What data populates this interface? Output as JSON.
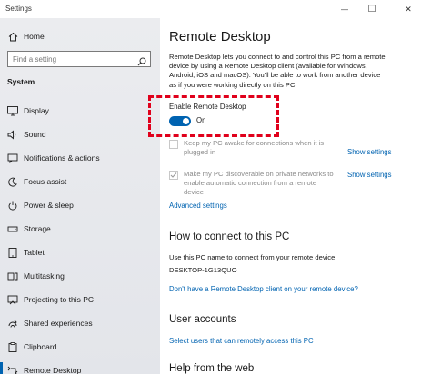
{
  "window": {
    "title": "Settings",
    "minimize": "—",
    "maximize": "☐",
    "close": "✕"
  },
  "sidebar": {
    "home": "Home",
    "search_placeholder": "Find a setting",
    "section": "System",
    "items": [
      {
        "label": "Display",
        "icon": "display-icon"
      },
      {
        "label": "Sound",
        "icon": "sound-icon"
      },
      {
        "label": "Notifications & actions",
        "icon": "notifications-icon"
      },
      {
        "label": "Focus assist",
        "icon": "focus-assist-icon"
      },
      {
        "label": "Power & sleep",
        "icon": "power-icon"
      },
      {
        "label": "Storage",
        "icon": "storage-icon"
      },
      {
        "label": "Tablet",
        "icon": "tablet-icon"
      },
      {
        "label": "Multitasking",
        "icon": "multitasking-icon"
      },
      {
        "label": "Projecting to this PC",
        "icon": "projecting-icon"
      },
      {
        "label": "Shared experiences",
        "icon": "shared-experiences-icon"
      },
      {
        "label": "Clipboard",
        "icon": "clipboard-icon"
      },
      {
        "label": "Remote Desktop",
        "icon": "remote-desktop-icon"
      }
    ],
    "selected": "Remote Desktop"
  },
  "main": {
    "title": "Remote Desktop",
    "description": "Remote Desktop lets you connect to and control this PC from a remote device by using a Remote Desktop client (available for Windows, Android, iOS and macOS). You'll be able to work from another device as if you were working directly on this PC.",
    "enable_label": "Enable Remote Desktop",
    "toggle_state": "On",
    "toggle_on": true,
    "option1": {
      "text": "Keep my PC awake for connections when it is plugged in",
      "checked": false,
      "link": "Show settings"
    },
    "option2": {
      "text": "Make my PC discoverable on private networks to enable automatic connection from a remote device",
      "checked": true,
      "link": "Show settings"
    },
    "advanced_link": "Advanced settings",
    "connect_heading": "How to connect to this PC",
    "connect_text": "Use this PC name to connect from your remote device:",
    "pc_name": "DESKTOP-1G13QUO",
    "client_link": "Don't have a Remote Desktop client on your remote device?",
    "accounts_heading": "User accounts",
    "accounts_link": "Select users that can remotely access this PC",
    "help_heading": "Help from the web"
  },
  "colors": {
    "accent": "#0063b1",
    "highlight": "#e0001b"
  }
}
